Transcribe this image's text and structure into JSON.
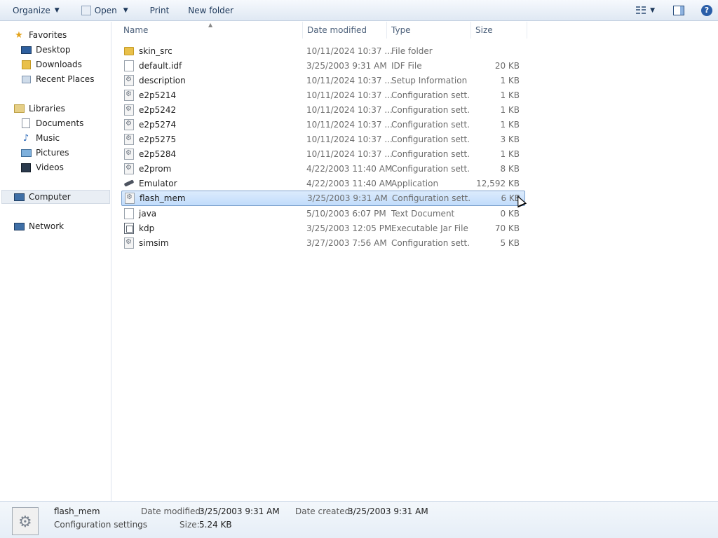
{
  "toolbar": {
    "organize": "Organize",
    "open": "Open",
    "print": "Print",
    "new_folder": "New folder"
  },
  "nav": {
    "favorites": "Favorites",
    "desktop": "Desktop",
    "downloads": "Downloads",
    "recent_places": "Recent Places",
    "libraries": "Libraries",
    "documents": "Documents",
    "music": "Music",
    "pictures": "Pictures",
    "videos": "Videos",
    "computer": "Computer",
    "network": "Network"
  },
  "columns": {
    "name": "Name",
    "date_modified": "Date modified",
    "type": "Type",
    "size": "Size"
  },
  "files": [
    {
      "name": "skin_src",
      "date": "10/11/2024 10:37 ...",
      "type": "File folder",
      "size": "",
      "icon": "folder-icon"
    },
    {
      "name": "default.idf",
      "date": "3/25/2003 9:31 AM",
      "type": "IDF File",
      "size": "20 KB",
      "icon": "document-icon"
    },
    {
      "name": "description",
      "date": "10/11/2024 10:37 ...",
      "type": "Setup Information",
      "size": "1 KB",
      "icon": "settings-file-icon"
    },
    {
      "name": "e2p5214",
      "date": "10/11/2024 10:37 ...",
      "type": "Configuration sett...",
      "size": "1 KB",
      "icon": "settings-file-icon"
    },
    {
      "name": "e2p5242",
      "date": "10/11/2024 10:37 ...",
      "type": "Configuration sett...",
      "size": "1 KB",
      "icon": "settings-file-icon"
    },
    {
      "name": "e2p5274",
      "date": "10/11/2024 10:37 ...",
      "type": "Configuration sett...",
      "size": "1 KB",
      "icon": "settings-file-icon"
    },
    {
      "name": "e2p5275",
      "date": "10/11/2024 10:37 ...",
      "type": "Configuration sett...",
      "size": "3 KB",
      "icon": "settings-file-icon"
    },
    {
      "name": "e2p5284",
      "date": "10/11/2024 10:37 ...",
      "type": "Configuration sett...",
      "size": "1 KB",
      "icon": "settings-file-icon"
    },
    {
      "name": "e2prom",
      "date": "4/22/2003 11:40 AM",
      "type": "Configuration sett...",
      "size": "8 KB",
      "icon": "settings-file-icon"
    },
    {
      "name": "Emulator",
      "date": "4/22/2003 11:40 AM",
      "type": "Application",
      "size": "12,592 KB",
      "icon": "application-icon"
    },
    {
      "name": "flash_mem",
      "date": "3/25/2003 9:31 AM",
      "type": "Configuration sett...",
      "size": "6 KB",
      "icon": "settings-file-icon",
      "selected": true
    },
    {
      "name": "java",
      "date": "5/10/2003 6:07 PM",
      "type": "Text Document",
      "size": "0 KB",
      "icon": "document-icon"
    },
    {
      "name": "kdp",
      "date": "3/25/2003 12:05 PM",
      "type": "Executable Jar File",
      "size": "70 KB",
      "icon": "jar-file-icon"
    },
    {
      "name": "simsim",
      "date": "3/27/2003 7:56 AM",
      "type": "Configuration sett...",
      "size": "5 KB",
      "icon": "settings-file-icon"
    }
  ],
  "details": {
    "name": "flash_mem",
    "type": "Configuration settings",
    "date_modified_label": "Date modified:",
    "date_modified": "3/25/2003 9:31 AM",
    "date_created_label": "Date created:",
    "date_created": "3/25/2003 9:31 AM",
    "size_label": "Size:",
    "size": "5.24 KB"
  }
}
